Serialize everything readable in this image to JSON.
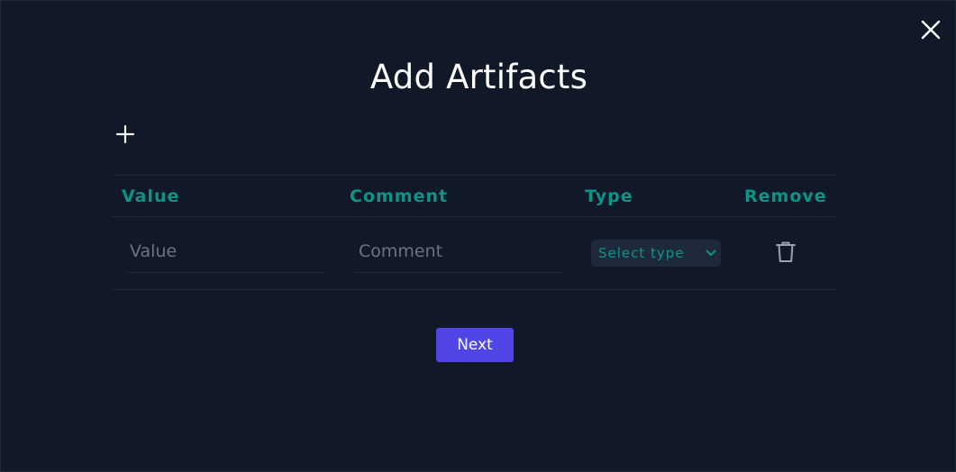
{
  "modal": {
    "title": "Add Artifacts",
    "close_icon": "close-icon",
    "add_icon": "plus-icon"
  },
  "table": {
    "columns": [
      "Value",
      "Comment",
      "Type",
      "Remove"
    ],
    "rows": [
      {
        "value": "",
        "value_placeholder": "Value",
        "comment": "",
        "comment_placeholder": "Comment",
        "type_selected": "Select type",
        "remove_icon": "trash-icon"
      }
    ]
  },
  "actions": {
    "next_label": "Next"
  },
  "colors": {
    "background": "#111827",
    "header_text": "#0d9488",
    "select_bg": "#1e293b",
    "primary_button": "#4f46e5",
    "border": "#1f2937",
    "placeholder": "#6b7280"
  }
}
